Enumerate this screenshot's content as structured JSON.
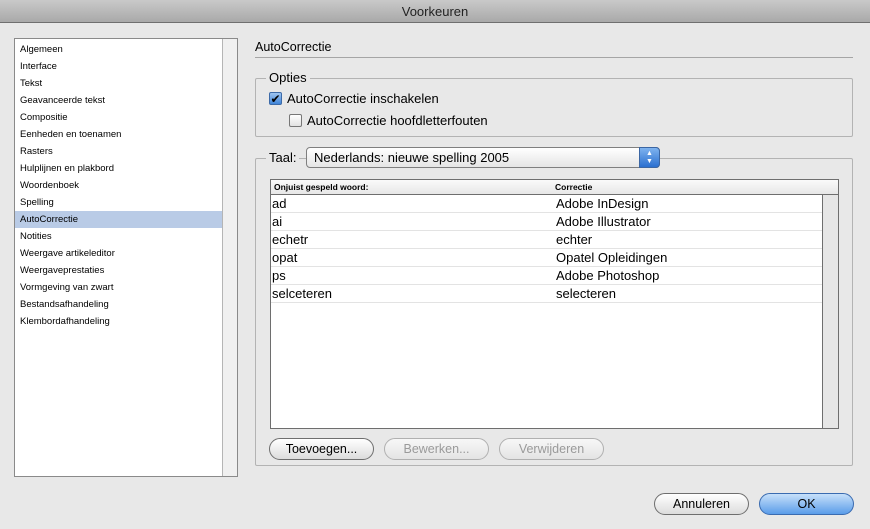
{
  "window": {
    "title": "Voorkeuren"
  },
  "sidebar": {
    "items": [
      {
        "label": "Algemeen"
      },
      {
        "label": "Interface"
      },
      {
        "label": "Tekst"
      },
      {
        "label": "Geavanceerde tekst"
      },
      {
        "label": "Compositie"
      },
      {
        "label": "Eenheden en toenamen"
      },
      {
        "label": "Rasters"
      },
      {
        "label": "Hulplijnen en plakbord"
      },
      {
        "label": "Woordenboek"
      },
      {
        "label": "Spelling"
      },
      {
        "label": "AutoCorrectie",
        "selected": true
      },
      {
        "label": "Notities"
      },
      {
        "label": "Weergave artikeleditor"
      },
      {
        "label": "Weergaveprestaties"
      },
      {
        "label": "Vormgeving van zwart"
      },
      {
        "label": "Bestandsafhandeling"
      },
      {
        "label": "Klembordafhandeling"
      }
    ]
  },
  "panel": {
    "title": "AutoCorrectie",
    "options": {
      "legend": "Opties",
      "enable": {
        "label": "AutoCorrectie inschakelen",
        "checked": true
      },
      "caps": {
        "label": "AutoCorrectie hoofdletterfouten",
        "checked": false
      }
    },
    "language": {
      "label": "Taal:",
      "value": "Nederlands: nieuwe spelling 2005"
    },
    "table": {
      "headers": [
        "Onjuist gespeld woord:",
        "Correctie"
      ],
      "rows": [
        [
          "ad",
          "Adobe InDesign"
        ],
        [
          "ai",
          "Adobe Illustrator"
        ],
        [
          "echetr",
          "echter"
        ],
        [
          "opat",
          "Opatel Opleidingen"
        ],
        [
          "ps",
          "Adobe Photoshop"
        ],
        [
          "selceteren",
          "selecteren"
        ]
      ]
    },
    "buttons": {
      "add": "Toevoegen...",
      "edit": "Bewerken...",
      "remove": "Verwijderen"
    }
  },
  "footer": {
    "cancel": "Annuleren",
    "ok": "OK"
  }
}
